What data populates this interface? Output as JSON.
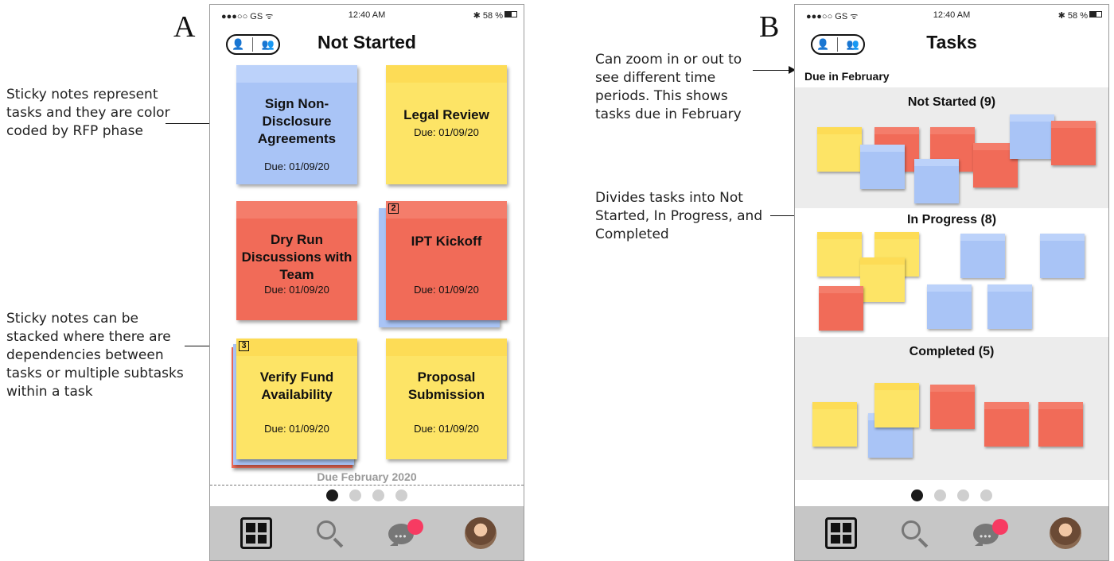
{
  "panels": {
    "left_letter": "A",
    "right_letter": "B"
  },
  "annotations": {
    "sticky_color": "Sticky notes represent tasks and they are color coded by RFP phase",
    "sticky_stacked": "Sticky notes can be stacked where there are dependencies between tasks or multiple subtasks within a task",
    "zoom": "Can zoom in or out to see different time periods. This shows tasks due in February",
    "divides": "Divides tasks into Not Started, In Progress, and Completed"
  },
  "status_bar": {
    "carrier": "●●●○○ GS ᯤ",
    "time": "12:40 AM",
    "battery": "✱ 58 %"
  },
  "phone_a": {
    "title": "Not Started",
    "notes": [
      {
        "title": "Sign Non-Disclosure Agreements",
        "due": "Due: 01/09/20",
        "color": "blue"
      },
      {
        "title": "Legal Review",
        "due": "Due: 01/09/20",
        "color": "yellow"
      },
      {
        "title": "Dry Run Discussions with Team",
        "due": "Due: 01/09/20",
        "color": "red"
      },
      {
        "title": "IPT Kickoff",
        "due": "Due: 01/09/20",
        "color": "red",
        "stack_count": "2"
      },
      {
        "title": "Verify Fund Availability",
        "due": "Due: 01/09/20",
        "color": "yellow",
        "stack_count": "3"
      },
      {
        "title": "Proposal Submission",
        "due": "Due: 01/09/20",
        "color": "yellow"
      }
    ],
    "footer": "Due February 2020",
    "active_page": 1
  },
  "phone_b": {
    "title": "Tasks",
    "month_label": "Due in February",
    "sections": {
      "not_started": "Not Started (9)",
      "in_progress": "In Progress (8)",
      "completed": "Completed (5)"
    },
    "active_page": 1
  },
  "tabbar": {
    "icons": [
      "grid-icon",
      "search-icon",
      "chat-icon",
      "avatar"
    ]
  },
  "colors": {
    "yellow": "#fde466",
    "blue": "#a9c4f6",
    "red": "#f16b58",
    "notification": "#f73b62",
    "tabbar": "#c6c6c6"
  }
}
